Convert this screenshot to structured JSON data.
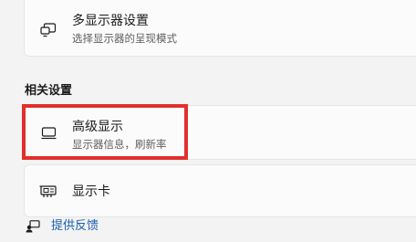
{
  "multi_display": {
    "title": "多显示器设置",
    "subtitle": "选择显示器的呈现模式",
    "icon": "multi-display-icon"
  },
  "related_settings": {
    "heading": "相关设置",
    "items": [
      {
        "title": "高级显示",
        "subtitle": "显示器信息，刷新率",
        "icon": "monitor-icon",
        "highlighted": true
      },
      {
        "title": "显示卡",
        "icon": "graphics-card-icon"
      }
    ]
  },
  "feedback": {
    "label": "提供反馈",
    "icon": "feedback-icon"
  },
  "colors": {
    "highlight": "#e0302d",
    "link": "#1a5fb4",
    "card": "#fbfbfb",
    "background": "#f3f3f3"
  }
}
